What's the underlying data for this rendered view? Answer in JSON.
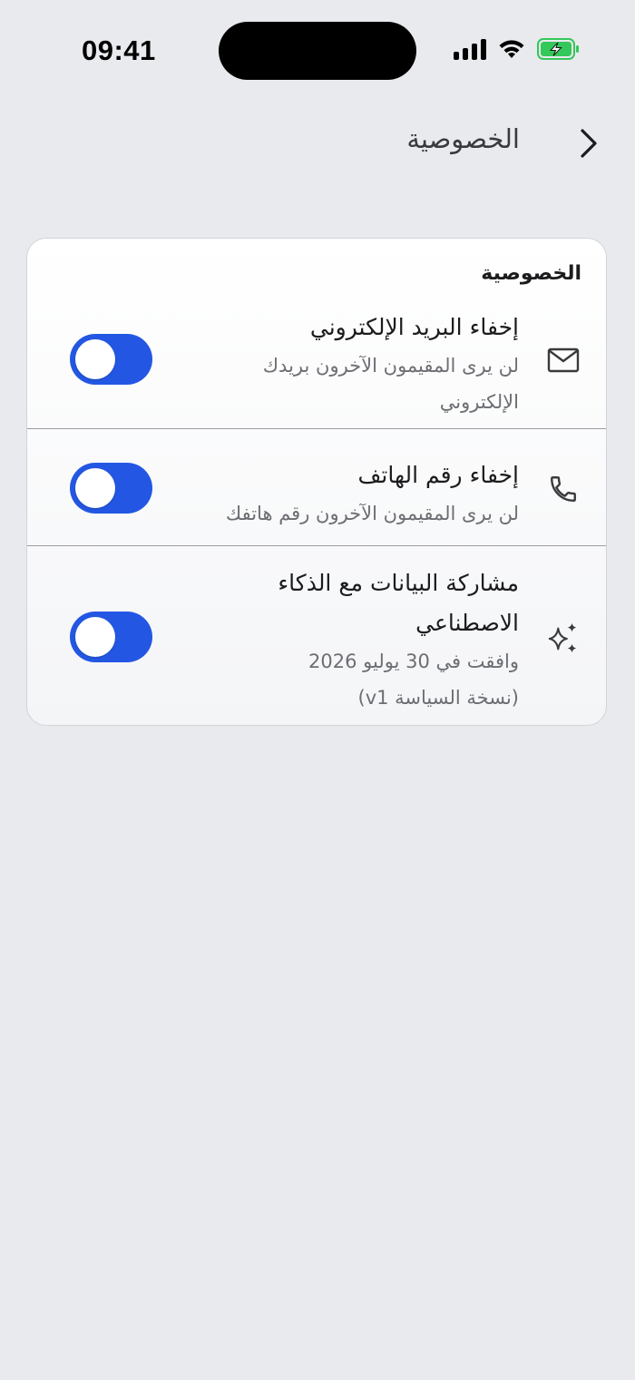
{
  "status_bar": {
    "time": "09:41"
  },
  "header": {
    "title": "الخصوصية",
    "back_icon": "chevron-right-icon"
  },
  "privacy_section": {
    "title": "الخصوصية",
    "rows": [
      {
        "icon": "mail-icon",
        "title": "إخفاء البريد الإلكتروني",
        "subtitle_lines": [
          "لن يرى المقيمون الآخرون بريدك",
          "الإلكتروني"
        ],
        "toggle": "on"
      },
      {
        "icon": "phone-icon",
        "title": "إخفاء رقم الهاتف",
        "subtitle_lines": [
          "لن يرى المقيمون الآخرون رقم هاتفك"
        ],
        "toggle": "on"
      },
      {
        "icon": "sparkles-icon",
        "title_lines": [
          "مشاركة البيانات مع الذكاء",
          "الاصطناعي"
        ],
        "subtitle_lines": [
          "وافقت في 30 يوليو 2026",
          "(نسخة السياسة v1)"
        ],
        "toggle": "on"
      }
    ]
  },
  "colors": {
    "background": "#e9eaee",
    "toggle_on": "#2357e3",
    "battery_fill": "#34c759"
  }
}
